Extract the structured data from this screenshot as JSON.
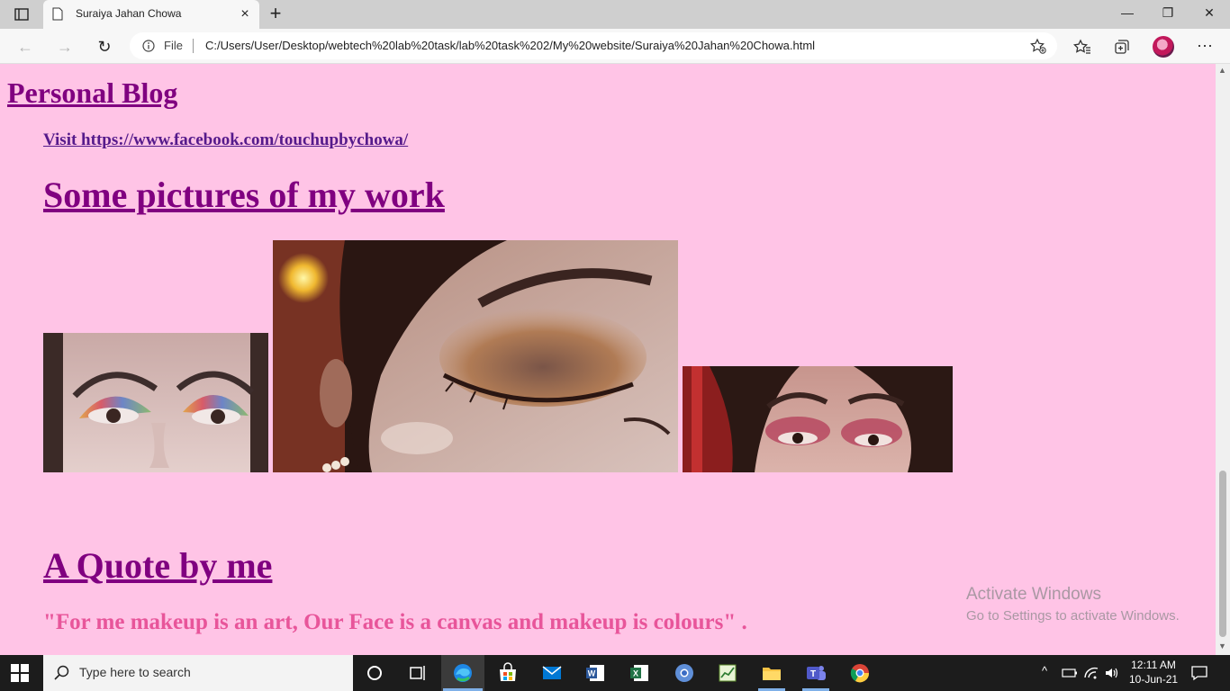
{
  "browser": {
    "tab_title": "Suraiya Jahan Chowa",
    "url_scheme": "File",
    "url": "C:/Users/User/Desktop/webtech%20lab%20task/lab%20task%202/My%20website/Suraiya%20Jahan%20Chowa.html",
    "accent": "#0078d4"
  },
  "page": {
    "heading": "Personal Blog",
    "visit_link": "Visit https://www.facebook.com/touchupbychowa/",
    "pictures_heading": "Some pictures of my work",
    "quote_heading": "A Quote by me",
    "quote_text": "\"For me makeup is an art, Our Face is a canvas and makeup is colours\" .",
    "background": "#ffc4e6",
    "heading_color": "#800080",
    "quote_color": "#e8559a"
  },
  "watermark": {
    "line1": "Activate Windows",
    "line2": "Go to Settings to activate Windows."
  },
  "taskbar": {
    "search_placeholder": "Type here to search",
    "time": "12:11 AM",
    "date": "10-Jun-21"
  }
}
